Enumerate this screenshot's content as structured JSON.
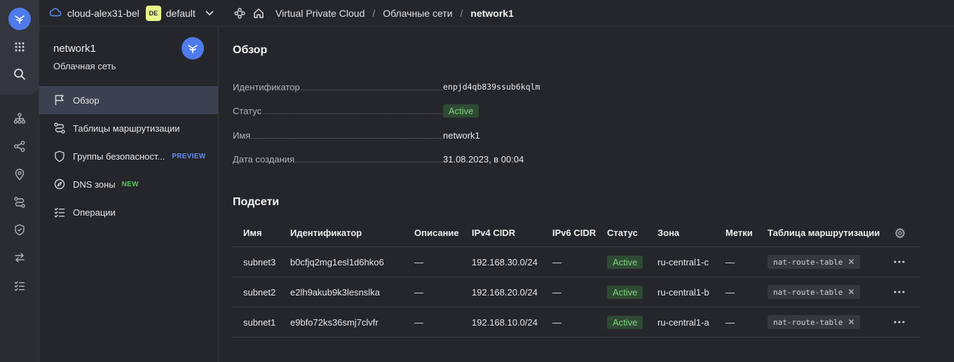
{
  "topbar": {
    "cloud_name": "cloud-alex31-bel",
    "folder_badge": "DE",
    "folder_name": "default",
    "breadcrumbs": [
      "Virtual Private Cloud",
      "Облачные сети",
      "network1"
    ]
  },
  "sidebar": {
    "title": "network1",
    "subtitle": "Облачная сеть",
    "items": [
      {
        "label": "Обзор",
        "icon": "flag-icon",
        "active": true
      },
      {
        "label": "Таблицы маршрутизации",
        "icon": "route-icon"
      },
      {
        "label": "Группы безопасност...",
        "icon": "shield-icon",
        "tag": "PREVIEW"
      },
      {
        "label": "DNS зоны",
        "icon": "compass-icon",
        "tag": "NEW"
      },
      {
        "label": "Операции",
        "icon": "list-icon"
      }
    ]
  },
  "overview": {
    "heading": "Обзор",
    "props": [
      {
        "key": "Идентификатор",
        "value": "enpjd4qb839ssub6kqlm"
      },
      {
        "key": "Статус",
        "value": "Active"
      },
      {
        "key": "Имя",
        "value": "network1"
      },
      {
        "key": "Дата создания",
        "value": "31.08.2023, в 00:04"
      }
    ]
  },
  "subnets": {
    "heading": "Подсети",
    "columns": [
      "Имя",
      "Идентификатор",
      "Описание",
      "IPv4 CIDR",
      "IPv6 CIDR",
      "Статус",
      "Зона",
      "Метки",
      "Таблица маршрутизации"
    ],
    "rows": [
      {
        "name": "subnet3",
        "id": "b0cfjq2mg1esl1d6hko6",
        "description": "—",
        "ipv4": "192.168.30.0/24",
        "ipv6": "—",
        "status": "Active",
        "zone": "ru-central1-c",
        "labels": "—",
        "route_table": "nat-route-table"
      },
      {
        "name": "subnet2",
        "id": "e2lh9akub9k3lesnslka",
        "description": "—",
        "ipv4": "192.168.20.0/24",
        "ipv6": "—",
        "status": "Active",
        "zone": "ru-central1-b",
        "labels": "—",
        "route_table": "nat-route-table"
      },
      {
        "name": "subnet1",
        "id": "e9bfo72ks36smj7clvfr",
        "description": "—",
        "ipv4": "192.168.10.0/24",
        "ipv6": "—",
        "status": "Active",
        "zone": "ru-central1-a",
        "labels": "—",
        "route_table": "nat-route-table"
      }
    ]
  },
  "colors": {
    "background": "#25262b",
    "accent": "#4f7bea",
    "active_nav": "#3b4150",
    "status_green": "#7fd37f",
    "preview_blue": "#5f8df5",
    "new_green": "#5fc25f",
    "folder_badge": "#e6f58c"
  }
}
